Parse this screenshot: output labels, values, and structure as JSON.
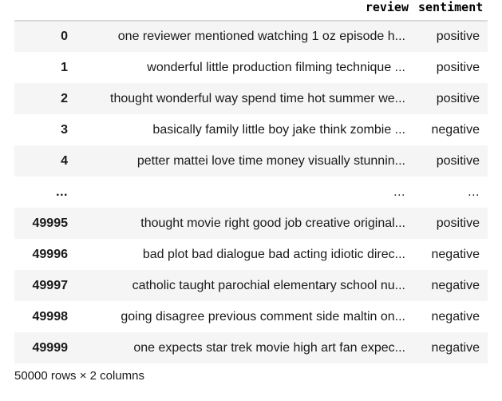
{
  "dataframe": {
    "index_header": "",
    "columns": [
      "review",
      "sentiment"
    ],
    "rows": [
      {
        "index": "0",
        "review": "one reviewer mentioned watching 1 oz episode h...",
        "sentiment": "positive"
      },
      {
        "index": "1",
        "review": "wonderful little production filming technique ...",
        "sentiment": "positive"
      },
      {
        "index": "2",
        "review": "thought wonderful way spend time hot summer we...",
        "sentiment": "positive"
      },
      {
        "index": "3",
        "review": "basically family little boy jake think zombie ...",
        "sentiment": "negative"
      },
      {
        "index": "4",
        "review": "petter mattei love time money visually stunnin...",
        "sentiment": "positive"
      },
      {
        "index": "...",
        "review": "...",
        "sentiment": "..."
      },
      {
        "index": "49995",
        "review": "thought movie right good job creative original...",
        "sentiment": "positive"
      },
      {
        "index": "49996",
        "review": "bad plot bad dialogue bad acting idiotic direc...",
        "sentiment": "negative"
      },
      {
        "index": "49997",
        "review": "catholic taught parochial elementary school nu...",
        "sentiment": "negative"
      },
      {
        "index": "49998",
        "review": "going disagree previous comment side maltin on...",
        "sentiment": "negative"
      },
      {
        "index": "49999",
        "review": "one expects star trek movie high art fan expec...",
        "sentiment": "negative"
      }
    ],
    "footer": "50000 rows × 2 columns",
    "colors": {
      "row_stripe": "#f5f5f5",
      "row_plain": "#ffffff",
      "header_rule": "#d9d9d9",
      "text": "#1a1a1a"
    }
  }
}
